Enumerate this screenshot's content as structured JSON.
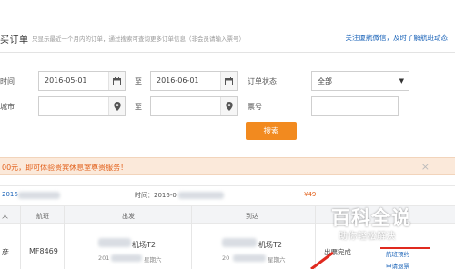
{
  "header": {
    "title": "买订单",
    "note": "只显示最近一个月内的订单，通过搜索可查询更多订单信息（非会员请输入票号）",
    "follow_link": "关注厦航微信，及时了解航班动态"
  },
  "search": {
    "time_label": "时间",
    "start_date": "2016-05-01",
    "to_label_1": "至",
    "end_date": "2016-06-01",
    "status_label": "订单状态",
    "status_value": "全部",
    "city_label": "城市",
    "to_label_2": "至",
    "ticket_label": "票号",
    "search_button": "搜索"
  },
  "promo": {
    "text": "00元，即可体验贵宾休息室尊贵服务！",
    "close": "×"
  },
  "order": {
    "order_no_prefix": "2016",
    "time_prefix": "时间：2016-0",
    "price": "¥49",
    "columns": [
      "人",
      "航班",
      "出发",
      "到达"
    ],
    "row": {
      "passenger": "彦",
      "flight": "MF8469",
      "depart_place": "机场T2",
      "depart_date_prefix": "201",
      "depart_weekday": "星期六",
      "arrive_place": "机场T2",
      "arrive_date_prefix": "20",
      "arrive_weekday": "星期六",
      "status": "出票完成",
      "action_1": "航班预约",
      "action_2": "申请退票"
    }
  },
  "watermark": {
    "title": "百科全说",
    "subtitle": "助你轻松解决"
  },
  "colors": {
    "accent_orange": "#f28a1f",
    "link_blue": "#1a63b8",
    "promo_bg": "#fbe9da",
    "promo_text": "#e2601b"
  }
}
